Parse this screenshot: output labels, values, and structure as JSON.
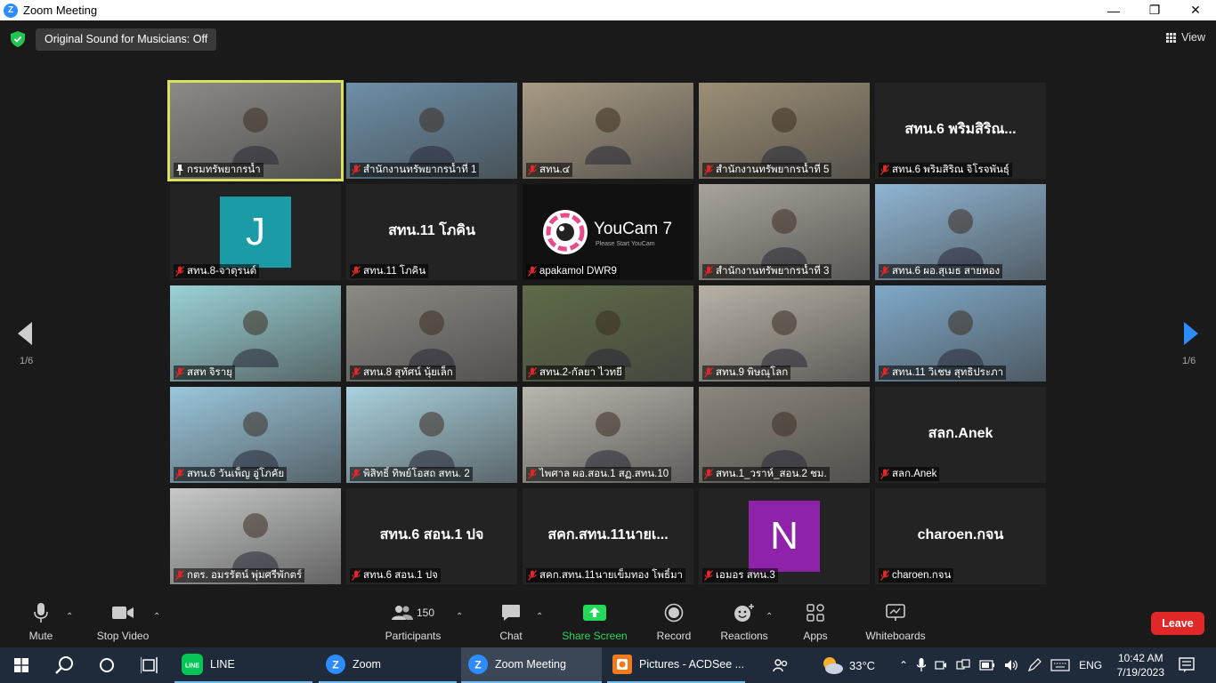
{
  "window": {
    "title": "Zoom Meeting",
    "controls": [
      "—",
      "❐",
      "✕"
    ]
  },
  "topbar": {
    "sound_label": "Original Sound for Musicians: Off",
    "view_label": "View"
  },
  "pagination": {
    "left": "1/6",
    "right": "1/6"
  },
  "tiles": [
    {
      "label": "กรมทรัพยากรน้ำ",
      "bigname": "",
      "avatar": "",
      "kind": "video",
      "bg": "#8b8a86",
      "pinned": true,
      "active": true
    },
    {
      "label": "สำนักงานทรัพยากรน้ำที่ 1",
      "bigname": "",
      "avatar": "",
      "kind": "video",
      "bg": "#6d8fa8"
    },
    {
      "label": "สทน.๔",
      "bigname": "",
      "avatar": "",
      "kind": "video",
      "bg": "#a89b84"
    },
    {
      "label": "สำนักงานทรัพยากรน้ำที่ 5",
      "bigname": "",
      "avatar": "",
      "kind": "video",
      "bg": "#9c8f76"
    },
    {
      "label": "สทน.6 พริมสิริณ จิโรจพันธุ์",
      "bigname": "สทน.6 พริมสิริณ...",
      "avatar": "",
      "kind": "name",
      "bg": "#232323"
    },
    {
      "label": "สทน.8-จาตุรนต์",
      "bigname": "",
      "avatar": "J",
      "kind": "avatar",
      "bg": "#232323",
      "avatar_color": "#1a9ba6"
    },
    {
      "label": "สทน.11 โภคิน",
      "bigname": "สทน.11 โภคิน",
      "avatar": "",
      "kind": "name",
      "bg": "#232323"
    },
    {
      "label": "apakamol DWR9",
      "bigname": "",
      "avatar": "",
      "kind": "youcam",
      "bg": "#111111",
      "youcam_title": "YouCam 7",
      "youcam_sub": "Please Start YouCam"
    },
    {
      "label": "สำนักงานทรัพยากรน้ำที่ 3",
      "bigname": "",
      "avatar": "",
      "kind": "video",
      "bg": "#a8a49a"
    },
    {
      "label": "สทน.6 ผอ.สุเมธ สายทอง",
      "bigname": "",
      "avatar": "",
      "kind": "video",
      "bg": "#8fb5d3"
    },
    {
      "label": "สสท จิรายุ",
      "bigname": "",
      "avatar": "",
      "kind": "video",
      "bg": "#9ad2d6"
    },
    {
      "label": "สทน.8 สุทัศน์ นุ้ยเล็ก",
      "bigname": "",
      "avatar": "",
      "kind": "video",
      "bg": "#8d8a84"
    },
    {
      "label": "สทน.2-กัลยา ไวทยี",
      "bigname": "",
      "avatar": "",
      "kind": "video",
      "bg": "#5f6b48"
    },
    {
      "label": "สทน.9 พิษณุโลก",
      "bigname": "",
      "avatar": "",
      "kind": "video",
      "bg": "#b8b2a6"
    },
    {
      "label": "สทน.11 วิเชษ สุทธิประภา",
      "bigname": "",
      "avatar": "",
      "kind": "video",
      "bg": "#7fa9c9"
    },
    {
      "label": "สทน.6 วันเพ็ญ อู่โภคัย",
      "bigname": "",
      "avatar": "",
      "kind": "video",
      "bg": "#9ac6dc"
    },
    {
      "label": "พิสิทธิ์ ทิพย์โอสถ สทน. 2",
      "bigname": "",
      "avatar": "",
      "kind": "video",
      "bg": "#a9d1de"
    },
    {
      "label": "ไพศาล ผอ.สอน.1 สฏ.สทน.10",
      "bigname": "",
      "avatar": "",
      "kind": "video",
      "bg": "#b9b6ad"
    },
    {
      "label": "สทน.1_วราห์_สอน.2 ชม.",
      "bigname": "",
      "avatar": "",
      "kind": "video",
      "bg": "#8c867c"
    },
    {
      "label": "สลก.Anek",
      "bigname": "สลก.Anek",
      "avatar": "",
      "kind": "name",
      "bg": "#232323"
    },
    {
      "label": "กตร. อมรรัตน์ พุ่มศรีพักตร์",
      "bigname": "",
      "avatar": "",
      "kind": "video",
      "bg": "#c7c9c8"
    },
    {
      "label": "สทน.6 สอน.1 ปจ",
      "bigname": "สทน.6 สอน.1 ปจ",
      "avatar": "",
      "kind": "name",
      "bg": "#232323"
    },
    {
      "label": "สคก.สทน.11นายเข็มทอง โพธิ์มา",
      "bigname": "สคก.สทน.11นายเ...",
      "avatar": "",
      "kind": "name",
      "bg": "#232323"
    },
    {
      "label": "เอมอร สทน.3",
      "bigname": "",
      "avatar": "N",
      "kind": "avatar",
      "bg": "#232323",
      "avatar_color": "#8e22a8"
    },
    {
      "label": "charoen.กจน",
      "bigname": "charoen.กจน",
      "avatar": "",
      "kind": "name",
      "bg": "#232323"
    }
  ],
  "toolbar": {
    "mute": "Mute",
    "stop_video": "Stop Video",
    "participants": "Participants",
    "participants_count": "150",
    "chat": "Chat",
    "share_screen": "Share Screen",
    "record": "Record",
    "reactions": "Reactions",
    "apps": "Apps",
    "whiteboards": "Whiteboards",
    "leave": "Leave"
  },
  "taskbar": {
    "apps": [
      {
        "name": "LINE",
        "icon": "line-icon"
      },
      {
        "name": "Zoom",
        "icon": "zoom-icon"
      },
      {
        "name": "Zoom Meeting",
        "icon": "zoom-icon"
      },
      {
        "name": "Pictures - ACDSee ...",
        "icon": "acdsee-icon"
      }
    ],
    "temperature": "33°C",
    "language": "ENG",
    "time": "10:42 AM",
    "date": "7/19/2023"
  },
  "colors": {
    "accent": "#2d8cff",
    "share": "#23d959",
    "leave": "#e02828",
    "active_border": "#d9e15d",
    "mic_off": "#e02828"
  }
}
